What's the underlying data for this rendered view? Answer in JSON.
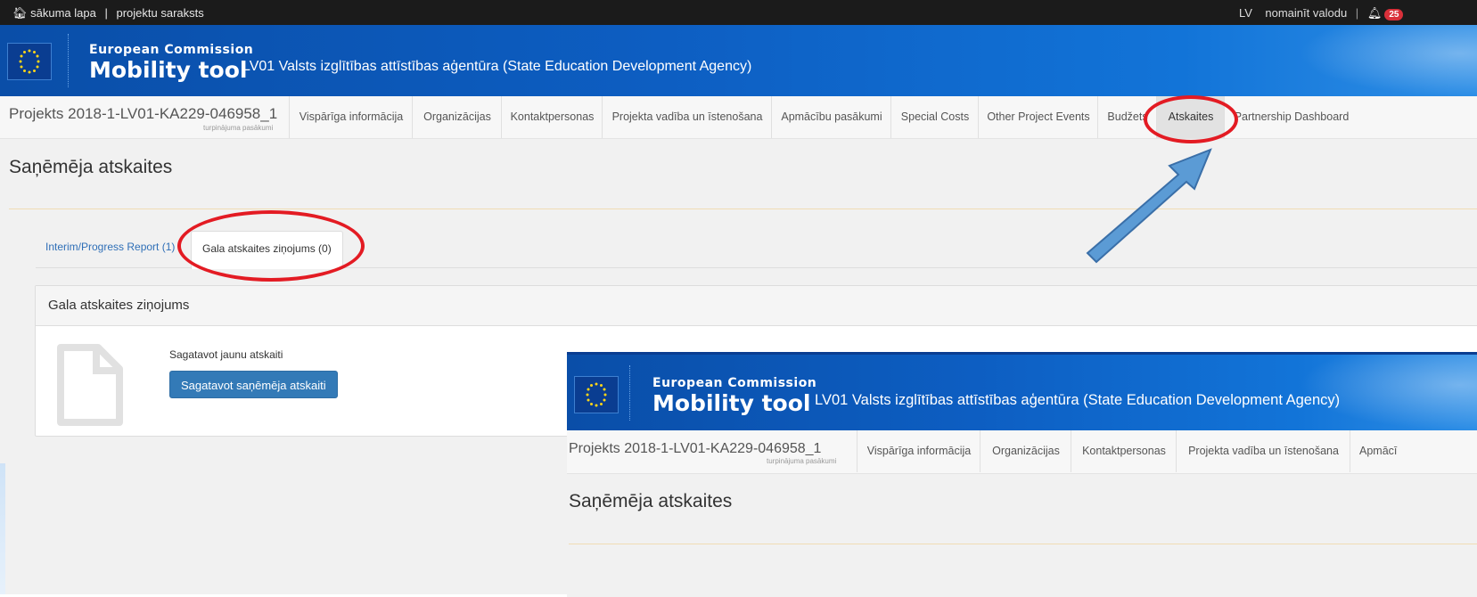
{
  "topbar": {
    "home_link": "sākuma lapa",
    "divider": "|",
    "projects_link": "projektu saraksts",
    "lang_code": "LV",
    "change_lang": "nomainīt valodu",
    "notif_count": "25"
  },
  "header": {
    "brand_small": "European Commission",
    "brand_big": "Mobility tool",
    "agency": "LV01 Valsts izglītības attīstības aģentūra (State Education Development Agency)"
  },
  "project_nav": {
    "project_title": "Projekts 2018-1-LV01-KA229-046958_1",
    "project_sub": "turpinājuma pasākumi",
    "items": [
      "Vispārīga informācija",
      "Organizācijas",
      "Kontaktpersonas",
      "Projekta vadība un īstenošana",
      "Apmācību pasākumi",
      "Special Costs",
      "Other Project Events",
      "Budžets",
      "Atskaites",
      "Partnership Dashboard"
    ],
    "active_item": "Atskaites"
  },
  "page": {
    "title": "Saņēmēja atskaites",
    "tabs": [
      "Interim/Progress Report (1)",
      "Gala atskaites ziņojums (0)"
    ],
    "panel_title": "Gala atskaites ziņojums",
    "prepare_label": "Sagatavot jaunu atskaiti",
    "prepare_button": "Sagatavot saņēmēja atskaiti"
  },
  "overlay": {
    "brand_small": "European Commission",
    "brand_big": "Mobility tool",
    "agency": "LV01 Valsts izglītības attīstības aģentūra (State Education Development Agency)",
    "project_title": "Projekts 2018-1-LV01-KA229-046958_1",
    "project_sub": "turpinājuma pasākumi",
    "items": [
      "Vispārīga informācija",
      "Organizācijas",
      "Kontaktpersonas",
      "Projekta vadība un īstenošana",
      "Apmācī"
    ],
    "title": "Saņēmēja atskaites"
  },
  "colors": {
    "header_blue": "#0d5ec2",
    "button_blue": "#337ab7",
    "annotation_red": "#e31b23",
    "arrow_blue": "#5b9bd5"
  },
  "icons": [
    "home-icon",
    "bell-icon",
    "eu-flag-icon",
    "document-icon"
  ]
}
